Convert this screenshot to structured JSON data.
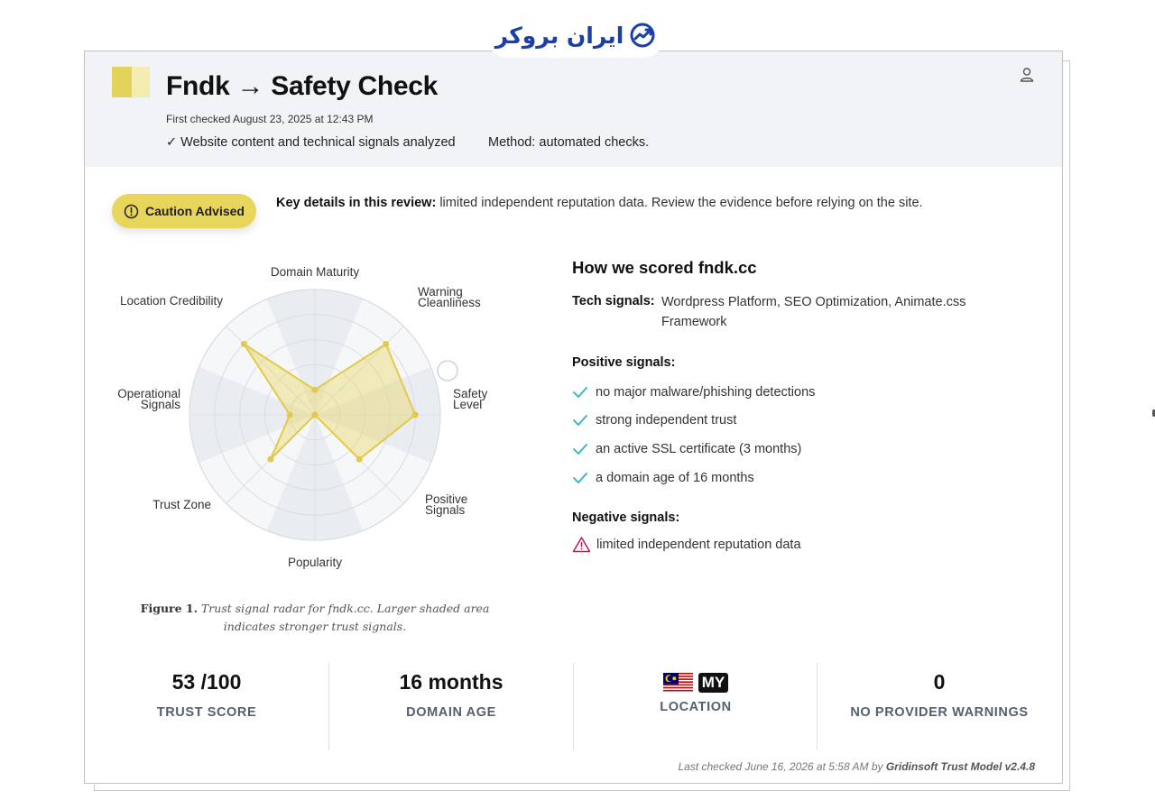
{
  "logo": {
    "text": "ایران بروکر"
  },
  "header": {
    "title": "Fndk → Safety Check",
    "first_checked": "First checked August 23, 2025 at 12:43 PM",
    "analyzed": "✓ Website content and technical signals analyzed",
    "method": "Method: automated checks."
  },
  "verdict": {
    "badge": "Caution Advised",
    "key_label": "Key details in this review:",
    "key_text": " limited independent reputation data. Review the evidence before relying on the site."
  },
  "chart_data": {
    "type": "radar",
    "axes": [
      "Domain Maturity",
      "Warning Cleanliness",
      "Safety Level",
      "Positive Signals",
      "Popularity",
      "Trust Zone",
      "Operational Signals",
      "Location Credibility"
    ],
    "range": [
      0,
      100
    ],
    "rings": 5,
    "values": [
      20,
      80,
      80,
      50,
      0,
      50,
      20,
      80
    ],
    "colors": {
      "fill": "#e8d76a",
      "stroke": "#e3c94a",
      "ring_light": "#f6f7f9",
      "ring_dark": "#e9ecf1"
    }
  },
  "figure_caption": {
    "label": "Figure 1.",
    "text": " Trust signal radar for fndk.cc. Larger shaded area indicates stronger trust signals."
  },
  "scoring": {
    "title": "How we scored fndk.cc",
    "tech_label": "Tech signals:",
    "tech_value": "Wordpress Platform, SEO Optimization, Animate.css Framework",
    "positive_label": "Positive signals:",
    "positive": [
      "no major malware/phishing detections",
      "strong independent trust",
      "an active SSL certificate (3 months)",
      "a domain age of 16 months"
    ],
    "negative_label": "Negative signals:",
    "negative": [
      "limited independent reputation data"
    ]
  },
  "stats": {
    "trust_score": {
      "value": "53 /100",
      "label": "TRUST SCORE"
    },
    "domain_age": {
      "value": "16 months",
      "label": "DOMAIN AGE"
    },
    "location": {
      "code": "MY",
      "label": "LOCATION"
    },
    "warnings": {
      "value": "0",
      "label": "NO PROVIDER WARNINGS"
    }
  },
  "footer": {
    "prefix": "Last checked June 16, 2026 at 5:58 AM by ",
    "model": "Gridinsoft Trust Model v2.4.8"
  }
}
